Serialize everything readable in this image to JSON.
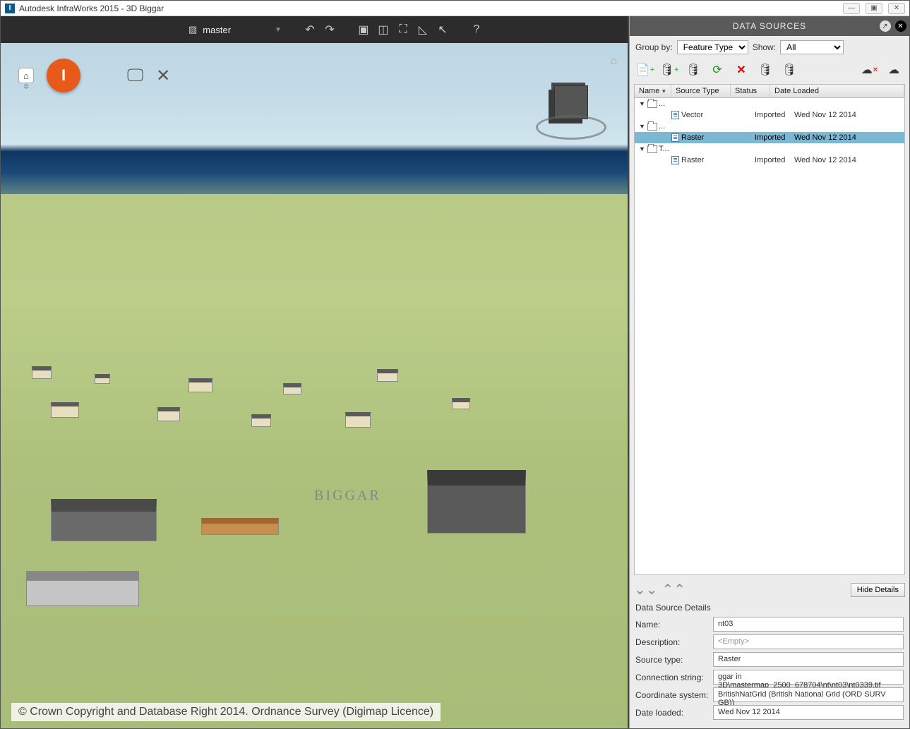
{
  "window": {
    "title": "Autodesk InfraWorks 2015 - 3D Biggar"
  },
  "toolbar": {
    "master_label": "master"
  },
  "map": {
    "label": "BIGGAR",
    "copyright": "© Crown Copyright and Database Right 2014. Ordnance Survey (Digimap Licence)"
  },
  "panel": {
    "title": "DATA SOURCES",
    "group_label": "Group by:",
    "group_value": "Feature Type",
    "show_label": "Show:",
    "show_value": "All",
    "columns": {
      "name": "Name",
      "src": "Source Type",
      "status": "Status",
      "date": "Date Loaded"
    },
    "tree": [
      {
        "type": "folder",
        "label": "..."
      },
      {
        "type": "item",
        "label": "Vector",
        "status": "Imported",
        "date": "Wed Nov 12 2014"
      },
      {
        "type": "folder",
        "label": "..."
      },
      {
        "type": "item",
        "label": "Raster",
        "status": "Imported",
        "date": "Wed Nov 12 2014",
        "selected": true
      },
      {
        "type": "folder",
        "label": "T..."
      },
      {
        "type": "item",
        "label": "Raster",
        "status": "Imported",
        "date": "Wed Nov 12 2014"
      }
    ],
    "hide_details": "Hide Details",
    "details_title": "Data Source Details",
    "details": {
      "name_lbl": "Name:",
      "name_val": "nt03",
      "desc_lbl": "Description:",
      "desc_val": "<Empty>",
      "type_lbl": "Source type:",
      "type_val": "Raster",
      "conn_lbl": "Connection string:",
      "conn_val": "ggar in 3D\\mastermap_2500_678704\\nt\\nt03\\nt0339.tif",
      "cs_lbl": "Coordinate system:",
      "cs_val": "BritishNatGrid (British National Grid (ORD SURV GB))",
      "date_lbl": "Date loaded:",
      "date_val": "Wed Nov 12 2014"
    }
  }
}
